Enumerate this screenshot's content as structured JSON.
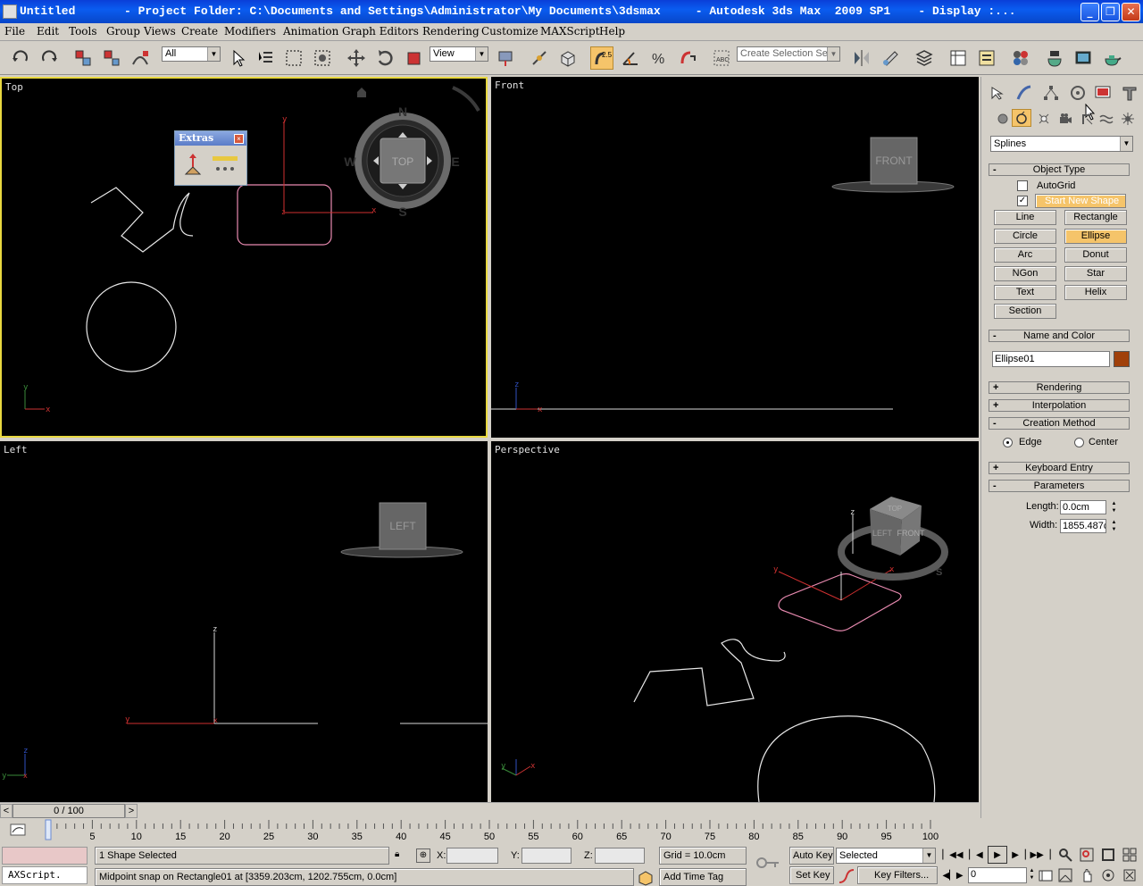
{
  "window": {
    "title": "Untitled       - Project Folder: C:\\Documents and Settings\\Administrator\\My Documents\\3dsmax     - Autodesk 3ds Max  2009 SP1    - Display :...",
    "min": "_",
    "max": "❐",
    "close": "✕"
  },
  "menu": [
    "File",
    "Edit",
    "Tools",
    "Group",
    "Views",
    "Create",
    "Modifiers",
    "Animation",
    "Graph Editors",
    "Rendering",
    "Customize",
    "MAXScript",
    "Help"
  ],
  "toolbar": {
    "filter": "All",
    "refcoord": "View",
    "snap_value": "2.5",
    "selection_set_placeholder": "Create Selection Set"
  },
  "viewports": {
    "top": "Top",
    "front": "Front",
    "left": "Left",
    "perspective": "Perspective"
  },
  "viewcube": {
    "top": "TOP",
    "front": "FRONT",
    "left": "LEFT",
    "compass": {
      "n": "N",
      "s": "S",
      "e": "E",
      "w": "W"
    }
  },
  "axes": {
    "x": "x",
    "y": "y",
    "z": "z"
  },
  "extras": {
    "title": "Extras",
    "close": "×"
  },
  "command_panel": {
    "category": "Splines",
    "object_type": {
      "title": "Object Type",
      "autogrid": "AutoGrid",
      "start_new_shape": "Start New Shape",
      "buttons": [
        [
          "Line",
          "Rectangle"
        ],
        [
          "Circle",
          "Ellipse"
        ],
        [
          "Arc",
          "Donut"
        ],
        [
          "NGon",
          "Star"
        ],
        [
          "Text",
          "Helix"
        ],
        [
          "Section"
        ]
      ],
      "active": "Ellipse"
    },
    "name_and_color": {
      "title": "Name and Color",
      "name": "Ellipse01",
      "color": "#a0400a"
    },
    "rendering": "Rendering",
    "interpolation": "Interpolation",
    "creation_method": {
      "title": "Creation Method",
      "edge": "Edge",
      "center": "Center",
      "selected": "Edge"
    },
    "keyboard_entry": "Keyboard Entry",
    "parameters": {
      "title": "Parameters",
      "length_label": "Length:",
      "length": "0.0cm",
      "width_label": "Width:",
      "width": "1855.487c"
    },
    "signs": {
      "minus": "-",
      "plus": "+"
    }
  },
  "timeline": {
    "frame": "0 / 100",
    "prev": "<",
    "next": ">",
    "ticks": [
      "0",
      "5",
      "10",
      "15",
      "20",
      "25",
      "30",
      "35",
      "40",
      "45",
      "50",
      "55",
      "60",
      "65",
      "70",
      "75",
      "80",
      "85",
      "90",
      "95",
      "100"
    ]
  },
  "status": {
    "selection": "1 Shape Selected",
    "prompt": "Midpoint snap on Rectangle01 at [3359.203cm, 1202.755cm, 0.0cm]",
    "x_label": "X:",
    "y_label": "Y:",
    "z_label": "Z:",
    "grid": "Grid = 10.0cm",
    "add_time_tag": "Add Time Tag",
    "auto_key": "Auto Key",
    "set_key": "Set Key",
    "key_mode": "Selected",
    "key_filters": "Key Filters...",
    "frame_field": "0",
    "maxscript": "AXScript."
  },
  "colors": {
    "active_viewport_border": "#e8d840",
    "toggle_active": "#f5c46a"
  }
}
